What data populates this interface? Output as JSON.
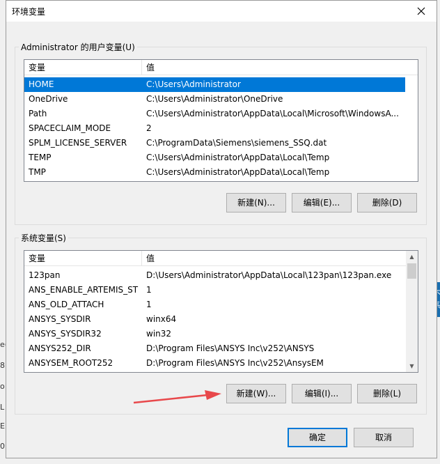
{
  "dialog": {
    "title": "环境变量",
    "user_group_label": "Administrator 的用户变量(U)",
    "system_group_label": "系统变量(S)",
    "ok_label": "确定",
    "cancel_label": "取消"
  },
  "user_vars": {
    "columns": [
      "变量",
      "值"
    ],
    "rows": [
      {
        "name": "HOME",
        "value": "C:\\Users\\Administrator"
      },
      {
        "name": "OneDrive",
        "value": "C:\\Users\\Administrator\\OneDrive"
      },
      {
        "name": "Path",
        "value": "C:\\Users\\Administrator\\AppData\\Local\\Microsoft\\WindowsA..."
      },
      {
        "name": "SPACECLAIM_MODE",
        "value": "2"
      },
      {
        "name": "SPLM_LICENSE_SERVER",
        "value": "C:\\ProgramData\\Siemens\\siemens_SSQ.dat"
      },
      {
        "name": "TEMP",
        "value": "C:\\Users\\Administrator\\AppData\\Local\\Temp"
      },
      {
        "name": "TMP",
        "value": "C:\\Users\\Administrator\\AppData\\Local\\Temp"
      }
    ],
    "new_label": "新建(N)...",
    "edit_label": "编辑(E)...",
    "delete_label": "删除(D)"
  },
  "system_vars": {
    "columns": [
      "变量",
      "值"
    ],
    "rows": [
      {
        "name": "123pan",
        "value": "D:\\Users\\Administrator\\AppData\\Local\\123pan\\123pan.exe"
      },
      {
        "name": "ANS_ENABLE_ARTEMIS_ST",
        "value": "1"
      },
      {
        "name": "ANS_OLD_ATTACH",
        "value": "1"
      },
      {
        "name": "ANSYS_SYSDIR",
        "value": "winx64"
      },
      {
        "name": "ANSYS_SYSDIR32",
        "value": "win32"
      },
      {
        "name": "ANSYS252_DIR",
        "value": "D:\\Program Files\\ANSYS Inc\\v252\\ANSYS"
      },
      {
        "name": "ANSYSEM_ROOT252",
        "value": "D:\\Program Files\\ANSYS Inc\\v252\\AnsysEM"
      }
    ],
    "new_label": "新建(W)...",
    "edit_label": "编辑(I)...",
    "delete_label": "删除(L)"
  },
  "background": {
    "left_fragments": [
      "e(",
      "8",
      "o",
      "L",
      "E",
      "0"
    ],
    "right_fragments": [
      "不",
      "系"
    ]
  },
  "colors": {
    "selection": "#0078d7",
    "annotation_arrow": "#e8484b",
    "primary_border": "#0078d7"
  }
}
